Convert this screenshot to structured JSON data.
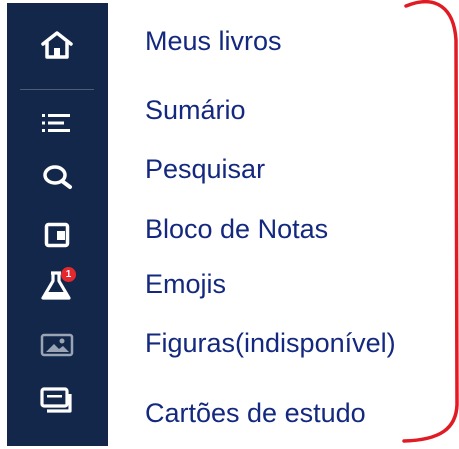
{
  "menu": {
    "items": [
      {
        "label": "Meus livros",
        "icon": "home-icon"
      },
      {
        "label": "Sumário",
        "icon": "list-icon"
      },
      {
        "label": "Pesquisar",
        "icon": "search-icon"
      },
      {
        "label": "Bloco de Notas",
        "icon": "notepad-icon"
      },
      {
        "label": "Emojis",
        "icon": "flask-icon",
        "badge": "1"
      },
      {
        "label": "Figuras(indisponível)",
        "icon": "image-icon"
      },
      {
        "label": "Cartões de estudo",
        "icon": "flashcards-icon"
      }
    ]
  },
  "colors": {
    "sidebar_bg": "#13274a",
    "label_text": "#13287e",
    "badge_bg": "#e5282e",
    "annotation_red": "#e01b24",
    "disabled_icon": "#9aa4b5"
  }
}
